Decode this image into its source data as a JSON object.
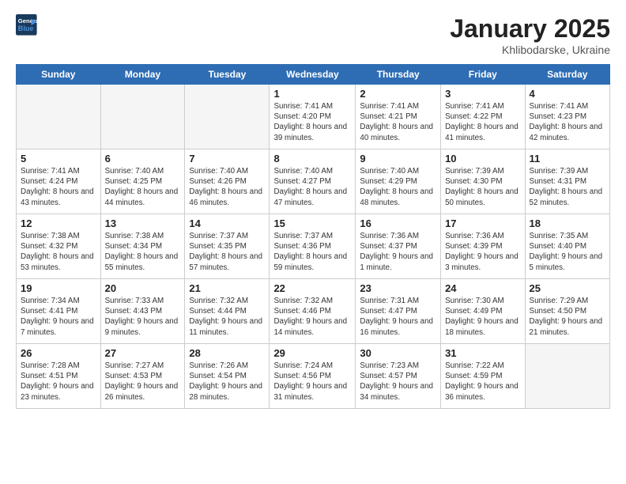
{
  "logo": {
    "line1": "General",
    "line2": "Blue"
  },
  "title": "January 2025",
  "location": "Khlibodarske, Ukraine",
  "days_of_week": [
    "Sunday",
    "Monday",
    "Tuesday",
    "Wednesday",
    "Thursday",
    "Friday",
    "Saturday"
  ],
  "weeks": [
    [
      {
        "day": "",
        "info": ""
      },
      {
        "day": "",
        "info": ""
      },
      {
        "day": "",
        "info": ""
      },
      {
        "day": "1",
        "info": "Sunrise: 7:41 AM\nSunset: 4:20 PM\nDaylight: 8 hours and 39 minutes."
      },
      {
        "day": "2",
        "info": "Sunrise: 7:41 AM\nSunset: 4:21 PM\nDaylight: 8 hours and 40 minutes."
      },
      {
        "day": "3",
        "info": "Sunrise: 7:41 AM\nSunset: 4:22 PM\nDaylight: 8 hours and 41 minutes."
      },
      {
        "day": "4",
        "info": "Sunrise: 7:41 AM\nSunset: 4:23 PM\nDaylight: 8 hours and 42 minutes."
      }
    ],
    [
      {
        "day": "5",
        "info": "Sunrise: 7:41 AM\nSunset: 4:24 PM\nDaylight: 8 hours and 43 minutes."
      },
      {
        "day": "6",
        "info": "Sunrise: 7:40 AM\nSunset: 4:25 PM\nDaylight: 8 hours and 44 minutes."
      },
      {
        "day": "7",
        "info": "Sunrise: 7:40 AM\nSunset: 4:26 PM\nDaylight: 8 hours and 46 minutes."
      },
      {
        "day": "8",
        "info": "Sunrise: 7:40 AM\nSunset: 4:27 PM\nDaylight: 8 hours and 47 minutes."
      },
      {
        "day": "9",
        "info": "Sunrise: 7:40 AM\nSunset: 4:29 PM\nDaylight: 8 hours and 48 minutes."
      },
      {
        "day": "10",
        "info": "Sunrise: 7:39 AM\nSunset: 4:30 PM\nDaylight: 8 hours and 50 minutes."
      },
      {
        "day": "11",
        "info": "Sunrise: 7:39 AM\nSunset: 4:31 PM\nDaylight: 8 hours and 52 minutes."
      }
    ],
    [
      {
        "day": "12",
        "info": "Sunrise: 7:38 AM\nSunset: 4:32 PM\nDaylight: 8 hours and 53 minutes."
      },
      {
        "day": "13",
        "info": "Sunrise: 7:38 AM\nSunset: 4:34 PM\nDaylight: 8 hours and 55 minutes."
      },
      {
        "day": "14",
        "info": "Sunrise: 7:37 AM\nSunset: 4:35 PM\nDaylight: 8 hours and 57 minutes."
      },
      {
        "day": "15",
        "info": "Sunrise: 7:37 AM\nSunset: 4:36 PM\nDaylight: 8 hours and 59 minutes."
      },
      {
        "day": "16",
        "info": "Sunrise: 7:36 AM\nSunset: 4:37 PM\nDaylight: 9 hours and 1 minute."
      },
      {
        "day": "17",
        "info": "Sunrise: 7:36 AM\nSunset: 4:39 PM\nDaylight: 9 hours and 3 minutes."
      },
      {
        "day": "18",
        "info": "Sunrise: 7:35 AM\nSunset: 4:40 PM\nDaylight: 9 hours and 5 minutes."
      }
    ],
    [
      {
        "day": "19",
        "info": "Sunrise: 7:34 AM\nSunset: 4:41 PM\nDaylight: 9 hours and 7 minutes."
      },
      {
        "day": "20",
        "info": "Sunrise: 7:33 AM\nSunset: 4:43 PM\nDaylight: 9 hours and 9 minutes."
      },
      {
        "day": "21",
        "info": "Sunrise: 7:32 AM\nSunset: 4:44 PM\nDaylight: 9 hours and 11 minutes."
      },
      {
        "day": "22",
        "info": "Sunrise: 7:32 AM\nSunset: 4:46 PM\nDaylight: 9 hours and 14 minutes."
      },
      {
        "day": "23",
        "info": "Sunrise: 7:31 AM\nSunset: 4:47 PM\nDaylight: 9 hours and 16 minutes."
      },
      {
        "day": "24",
        "info": "Sunrise: 7:30 AM\nSunset: 4:49 PM\nDaylight: 9 hours and 18 minutes."
      },
      {
        "day": "25",
        "info": "Sunrise: 7:29 AM\nSunset: 4:50 PM\nDaylight: 9 hours and 21 minutes."
      }
    ],
    [
      {
        "day": "26",
        "info": "Sunrise: 7:28 AM\nSunset: 4:51 PM\nDaylight: 9 hours and 23 minutes."
      },
      {
        "day": "27",
        "info": "Sunrise: 7:27 AM\nSunset: 4:53 PM\nDaylight: 9 hours and 26 minutes."
      },
      {
        "day": "28",
        "info": "Sunrise: 7:26 AM\nSunset: 4:54 PM\nDaylight: 9 hours and 28 minutes."
      },
      {
        "day": "29",
        "info": "Sunrise: 7:24 AM\nSunset: 4:56 PM\nDaylight: 9 hours and 31 minutes."
      },
      {
        "day": "30",
        "info": "Sunrise: 7:23 AM\nSunset: 4:57 PM\nDaylight: 9 hours and 34 minutes."
      },
      {
        "day": "31",
        "info": "Sunrise: 7:22 AM\nSunset: 4:59 PM\nDaylight: 9 hours and 36 minutes."
      },
      {
        "day": "",
        "info": ""
      }
    ]
  ]
}
